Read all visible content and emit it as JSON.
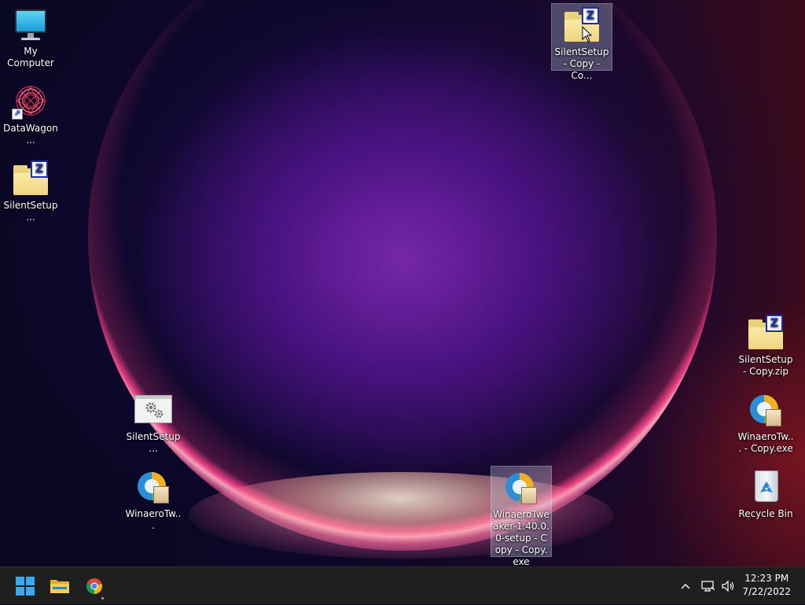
{
  "desktop": {
    "icons": {
      "my_computer": "My Computer",
      "datawagon": "DataWagon...",
      "silentsetup_left": "SilentSetup...",
      "silentsetup_top": "SilentSetup - Copy - Co...",
      "silentsetup_zip": "SilentSetup - Copy.zip",
      "winaero_copy": "WinaeroTw... - Copy.exe",
      "recycle_bin": "Recycle Bin",
      "silentsetup_exe": "SilentSetup...",
      "winaero_left": "WinaeroTw...",
      "winaero_selected": "WinaeroTweaker-1.40.0.0-setup - Copy - Copy.exe"
    }
  },
  "taskbar": {
    "clock": {
      "time": "12:23 PM",
      "date": "7/22/2022"
    }
  },
  "icon_names": [
    "computer-icon",
    "app-spiral-icon",
    "zip-folder-icon",
    "settings-window-icon",
    "installer-icon",
    "recycle-bin-icon",
    "windows-start-icon",
    "file-explorer-icon",
    "chrome-icon",
    "chevron-up-icon",
    "network-icon",
    "volume-icon"
  ],
  "colors": {
    "taskbar_bg": "#1f1f1f",
    "start_blue": "#3aa8f0",
    "zip_badge": "#1c2fb0",
    "folder_yellow": "#efd47e"
  }
}
